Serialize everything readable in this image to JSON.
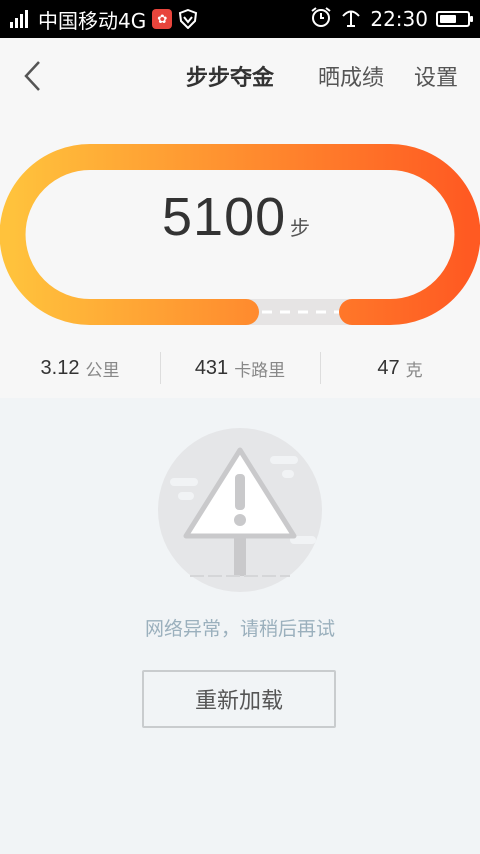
{
  "status_bar": {
    "carrier": "中国移动4G",
    "time": "22:30",
    "battery_level": 0.6
  },
  "nav": {
    "title": "步步夺金",
    "share_label": "晒成绩",
    "settings_label": "设置"
  },
  "steps": {
    "value": "5100",
    "unit": "步"
  },
  "stats": [
    {
      "value": "3.12",
      "unit": "公里"
    },
    {
      "value": "431",
      "unit": "卡路里"
    },
    {
      "value": "47",
      "unit": "克"
    }
  ],
  "error": {
    "message": "网络异常，请稍后再试",
    "reload_label": "重新加载"
  },
  "colors": {
    "ring_start": "#ffc23c",
    "ring_end": "#ff5a22",
    "ring_track": "#e6e4e4"
  }
}
